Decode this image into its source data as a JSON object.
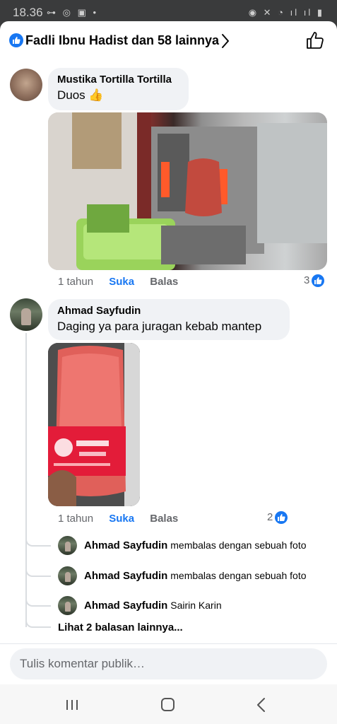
{
  "status_bar": {
    "time": "18.36",
    "left_icons": "⊶ ◎ ▣ •",
    "right_icons": "◉ ✕ ◔ ıl ıl ▮"
  },
  "reactions": {
    "names": "Fadli Ibnu Hadist dan 58 lainnya"
  },
  "comments": [
    {
      "author": "Mustika Tortilla Tortilla",
      "text": "Duos 👍",
      "time": "1 tahun",
      "like_label": "Suka",
      "reply_label": "Balas",
      "like_count": "3"
    },
    {
      "author": "Ahmad Sayfudin",
      "text": "Daging ya para juragan kebab mantep",
      "time": "1 tahun",
      "like_label": "Suka",
      "reply_label": "Balas",
      "like_count": "2"
    }
  ],
  "replies": [
    {
      "author": "Ahmad Sayfudin",
      "text": "membalas dengan sebuah foto"
    },
    {
      "author": "Ahmad Sayfudin",
      "text": "membalas dengan sebuah foto"
    },
    {
      "author": "Ahmad Sayfudin",
      "text": "Sairin Karin"
    }
  ],
  "more_replies": "Lihat 2 balasan lainnya...",
  "composer": {
    "placeholder": "Tulis komentar publik…"
  },
  "colors": {
    "accent": "#1877f2",
    "bubble": "#f0f2f5",
    "secondary_text": "#65676b"
  }
}
